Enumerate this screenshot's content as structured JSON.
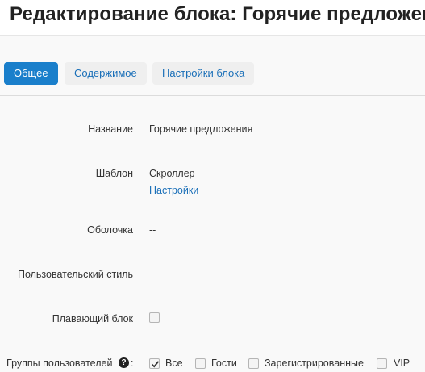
{
  "header": {
    "title": "Редактирование блока: Горячие предложения"
  },
  "tabs": [
    {
      "label": "Общее",
      "active": true
    },
    {
      "label": "Содержимое",
      "active": false
    },
    {
      "label": "Настройки блока",
      "active": false
    }
  ],
  "form": {
    "name": {
      "label": "Название",
      "value": "Горячие предложения"
    },
    "template": {
      "label": "Шаблон",
      "value": "Скроллер",
      "link": "Настройки"
    },
    "wrapper": {
      "label": "Оболочка",
      "value": "--"
    },
    "custom_style": {
      "label": "Пользовательский стиль",
      "value": ""
    },
    "floating": {
      "label": "Плавающий блок",
      "checked": false
    },
    "groups": {
      "label": "Группы пользователей",
      "help_icon": "question-circle-icon",
      "colon": ":",
      "options": [
        {
          "label": "Все",
          "checked": true
        },
        {
          "label": "Гости",
          "checked": false
        },
        {
          "label": "Зарегистрированные",
          "checked": false
        },
        {
          "label": "VIP",
          "checked": false
        }
      ]
    }
  },
  "colors": {
    "accent": "#1a7fcb",
    "link": "#1a6fb8"
  }
}
